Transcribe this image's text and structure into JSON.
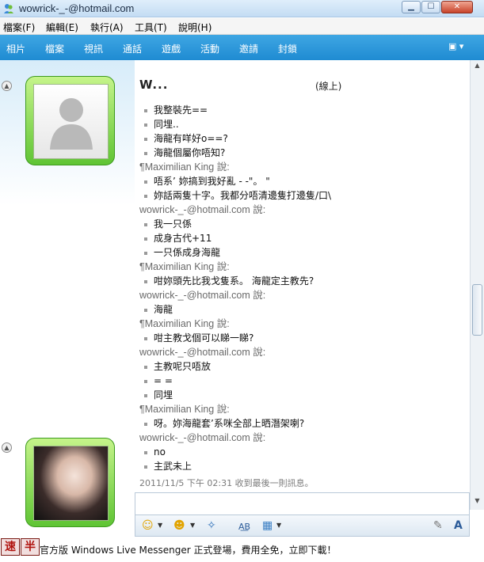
{
  "window": {
    "title": "wowrick-_-@hotmail.com",
    "app_icon": "messenger-icon"
  },
  "menu": {
    "items": [
      "檔案(F)",
      "編輯(E)",
      "執行(A)",
      "工具(T)",
      "說明(H)"
    ]
  },
  "toolbar": {
    "items": [
      "相片",
      "檔案",
      "視訊",
      "通話",
      "遊戲",
      "活動",
      "邀請",
      "封鎖"
    ]
  },
  "contact": {
    "name": "W...",
    "status": "(線上)"
  },
  "conversation": {
    "lines": [
      {
        "type": "msg",
        "text": "我整裝先=="
      },
      {
        "type": "msg",
        "text": "同埋.."
      },
      {
        "type": "msg",
        "text": "海龍有咩好o==?"
      },
      {
        "type": "msg",
        "text": "海龍個屬你唔知?"
      },
      {
        "type": "sender",
        "text": "¶Maximilian King 說:"
      },
      {
        "type": "msg",
        "text": "唔系’ 妳搞到我好亂 - -\"。 \""
      },
      {
        "type": "msg",
        "text": "妳話兩隻十字。我都分唔清邊隻打邊隻/口\\"
      },
      {
        "type": "sender",
        "text": "wowrick-_-@hotmail.com 說:"
      },
      {
        "type": "msg",
        "text": "我一只係"
      },
      {
        "type": "msg",
        "text": "成身古代+11"
      },
      {
        "type": "msg",
        "text": "一只係成身海龍"
      },
      {
        "type": "sender",
        "text": "¶Maximilian King 說:"
      },
      {
        "type": "msg",
        "text": "咁妳頭先比我戈隻系。 海龍定主教先?"
      },
      {
        "type": "sender",
        "text": "wowrick-_-@hotmail.com 說:"
      },
      {
        "type": "msg",
        "text": "海龍"
      },
      {
        "type": "sender",
        "text": "¶Maximilian King 說:"
      },
      {
        "type": "msg",
        "text": "咁主教戈個可以睇一睇?"
      },
      {
        "type": "sender",
        "text": "wowrick-_-@hotmail.com 說:"
      },
      {
        "type": "msg",
        "text": "主教呢只唔放"
      },
      {
        "type": "msg",
        "text": "= ="
      },
      {
        "type": "msg",
        "text": "同埋"
      },
      {
        "type": "sender",
        "text": "¶Maximilian King 說:"
      },
      {
        "type": "msg",
        "text": "呀。妳海龍套’系咪全部上晒潛架喇?"
      },
      {
        "type": "sender",
        "text": "wowrick-_-@hotmail.com 說:"
      },
      {
        "type": "msg",
        "text": "no"
      },
      {
        "type": "msg",
        "text": "主武未上"
      }
    ],
    "last_message_time": "2011/11/5 下午 02:31 收到最後一則訊息。"
  },
  "compose": {
    "value": "",
    "toolbar_icons": [
      "emoticon-icon",
      "wink-icon",
      "nudge-icon",
      "font-icon",
      "background-icon",
      "handwriting-icon",
      "text-format-icon"
    ]
  },
  "ad": {
    "logo_left": "速",
    "logo_right": "半",
    "text": "官方版 Windows Live Messenger 正式登場，費用全免，立即下載！"
  },
  "colors": {
    "toolbar": "#1f8bd2",
    "frame_green": "#5fc434",
    "sender_gray": "#6a6a6a"
  }
}
